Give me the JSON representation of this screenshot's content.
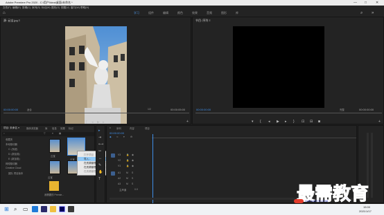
{
  "window": {
    "title": "Adobe Premiere Pro 2020 - C:\\用户\\Idea\\桌面\\未命名 *",
    "controls": [
      "—",
      "□",
      "✕"
    ]
  },
  "menu": [
    "文件(F)",
    "编辑(E)",
    "剪辑(C)",
    "序列(S)",
    "标记(M)",
    "图形(G)",
    "视图(V)",
    "窗口(W)",
    "帮助(H)"
  ],
  "workspaces": [
    {
      "label": "学习",
      "active": true
    },
    {
      "label": "组件",
      "active": false
    },
    {
      "label": "编辑",
      "active": false
    },
    {
      "label": "颜色",
      "active": false
    },
    {
      "label": "效果",
      "active": false
    },
    {
      "label": "音频",
      "active": false
    },
    {
      "label": "图形",
      "active": false
    },
    {
      "label": "库",
      "active": false
    }
  ],
  "source_monitor": {
    "title": "源: 云宝.jpg ≡",
    "timecode_in": "00:00:00:00",
    "fit": "适合",
    "timecode_out": "00:00:05:00",
    "zoom": "1/2"
  },
  "program_monitor": {
    "title": "节目: 序列 ≡",
    "timecode_in": "00:00:00:00",
    "fit": "完整",
    "timecode_out": "00:00:00:00"
  },
  "project": {
    "tabs": [
      "项目: 未命名 ≡",
      "媒体浏览器",
      "库",
      "信息",
      "效果",
      "标记"
    ],
    "tree": [
      "收藏夹",
      "本地驱动器",
      "C: (系统)",
      "D: (新加卷)",
      "E: (新加卷)",
      "网络驱动器",
      "Creative Cloud",
      "团队 项目版本"
    ],
    "clips": [
      "云宝",
      "云宝",
      "云宝",
      "云宝",
      "文件夹"
    ],
    "folder_label": "我需要的 Premie..."
  },
  "context_menu": {
    "items": [
      "打开项目",
      "导入...",
      "在资源管理器中打开",
      "在资源管理器中显示",
      "在资源管理器中查看"
    ],
    "highlighted_index": 1
  },
  "timeline": {
    "tabs": [
      "x",
      "序列",
      "内容",
      "项目"
    ],
    "timecode": "00:00:00:00",
    "video_tracks": [
      "V3",
      "V2",
      "V1"
    ],
    "audio_tracks": [
      "A1",
      "A2",
      "A3"
    ],
    "master": "主声道",
    "master_value": "0.0"
  },
  "taskbar": {
    "time": "15:00",
    "date": "2021/1/17"
  },
  "watermark": {
    "text": "最需教育",
    "sub": "XUEJIAOYU.COM"
  }
}
